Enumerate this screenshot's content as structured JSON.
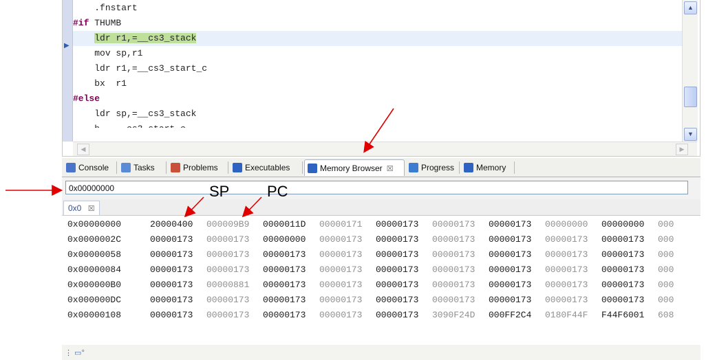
{
  "editor": {
    "lines": [
      {
        "indent": "    ",
        "text": ".fnstart",
        "kind": "plain"
      },
      {
        "indent": "",
        "keyword": "#if",
        "text": " THUMB",
        "kind": "directive"
      },
      {
        "indent": "    ",
        "text": "ldr r1,=__cs3_stack",
        "kind": "current"
      },
      {
        "indent": "    ",
        "text": "mov sp,r1",
        "kind": "plain"
      },
      {
        "indent": "    ",
        "text": "ldr r1,=__cs3_start_c",
        "kind": "plain"
      },
      {
        "indent": "    ",
        "text": "bx  r1",
        "kind": "plain"
      },
      {
        "indent": "",
        "keyword": "#else",
        "text": "",
        "kind": "directive"
      },
      {
        "indent": "    ",
        "text": "ldr sp,=__cs3_stack",
        "kind": "plain"
      },
      {
        "indent": "    ",
        "text": "b   __cs3_start_c",
        "kind": "clipped"
      }
    ],
    "current_line_icon": "instruction-pointer-icon"
  },
  "tabs": [
    {
      "label": "Console",
      "icon": "console-icon",
      "color": "#4a74c9"
    },
    {
      "label": "Tasks",
      "icon": "tasks-icon",
      "color": "#5b8ad6"
    },
    {
      "label": "Problems",
      "icon": "problems-icon",
      "color": "#c9503a"
    },
    {
      "label": "Executables",
      "icon": "executables-icon",
      "color": "#2f63c2"
    },
    {
      "label": "Memory Browser",
      "icon": "memory-icon",
      "color": "#2f63c2",
      "active": true,
      "close": "☒"
    },
    {
      "label": "Progress",
      "icon": "progress-icon",
      "color": "#3b7bd0"
    },
    {
      "label": "Memory",
      "icon": "memory-icon",
      "color": "#2f63c2"
    }
  ],
  "address_bar": {
    "value": "0x00000000"
  },
  "rendering_tab": {
    "label": "0x0",
    "close": "☒"
  },
  "memory": {
    "rows": [
      {
        "address": "0x00000000",
        "cells": [
          "20000400",
          "000009B9",
          "0000011D",
          "00000171",
          "00000173",
          "00000173",
          "00000173",
          "00000000",
          "00000000",
          "000"
        ]
      },
      {
        "address": "0x0000002C",
        "cells": [
          "00000173",
          "00000173",
          "00000000",
          "00000173",
          "00000173",
          "00000173",
          "00000173",
          "00000173",
          "00000173",
          "000"
        ]
      },
      {
        "address": "0x00000058",
        "cells": [
          "00000173",
          "00000173",
          "00000173",
          "00000173",
          "00000173",
          "00000173",
          "00000173",
          "00000173",
          "00000173",
          "000"
        ]
      },
      {
        "address": "0x00000084",
        "cells": [
          "00000173",
          "00000173",
          "00000173",
          "00000173",
          "00000173",
          "00000173",
          "00000173",
          "00000173",
          "00000173",
          "000"
        ]
      },
      {
        "address": "0x000000B0",
        "cells": [
          "00000173",
          "00000881",
          "00000173",
          "00000173",
          "00000173",
          "00000173",
          "00000173",
          "00000173",
          "00000173",
          "000"
        ]
      },
      {
        "address": "0x000000DC",
        "cells": [
          "00000173",
          "00000173",
          "00000173",
          "00000173",
          "00000173",
          "00000173",
          "00000173",
          "00000173",
          "00000173",
          "000"
        ]
      },
      {
        "address": "0x00000108",
        "cells": [
          "00000173",
          "00000173",
          "00000173",
          "00000173",
          "00000173",
          "3090F24D",
          "000FF2C4",
          "0180F44F",
          "F44F6001",
          "608"
        ]
      }
    ]
  },
  "annotations": {
    "sp_label": "SP",
    "pc_label": "PC"
  },
  "colors": {
    "annotation_arrow": "#e00000",
    "highlight": "#bfe09b",
    "ruler": "#d5dcef"
  }
}
